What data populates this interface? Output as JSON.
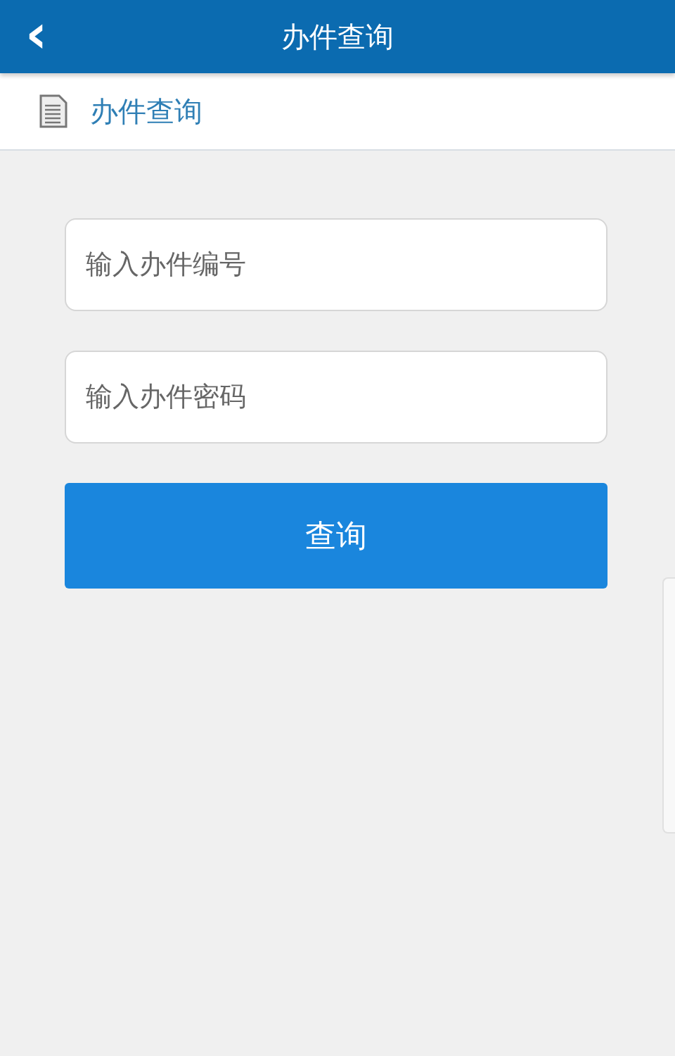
{
  "header": {
    "back_icon": "‹",
    "title": "办件查询"
  },
  "section": {
    "title": "办件查询"
  },
  "form": {
    "fields": [
      {
        "placeholder": "输入办件编号"
      },
      {
        "placeholder": "输入办件密码"
      }
    ],
    "submit": "查询"
  }
}
